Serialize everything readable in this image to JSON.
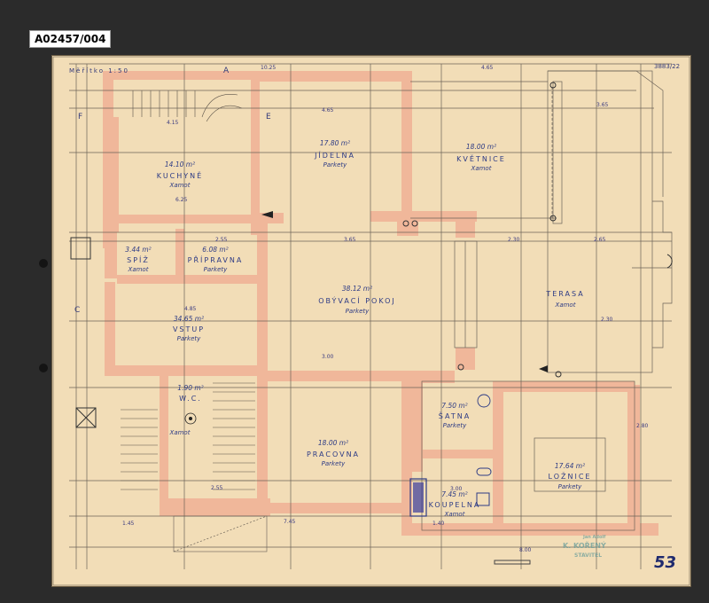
{
  "archive_code": "A02457/004",
  "page_number": "53",
  "scale": "Měřítko 1:50",
  "drawing_number": "3883/22",
  "stamp": {
    "line1": "Jan Adolf",
    "line2": "K. KOŘENÝ",
    "line3": "STAVITEL"
  },
  "section_marks": {
    "a": "A",
    "e": "E",
    "f": "F",
    "c": "C"
  },
  "rooms": [
    {
      "name": "KUCHYNĚ",
      "area": "14.10 m²",
      "floor": "Xamot"
    },
    {
      "name": "JÍDELNA",
      "area": "17.80 m²",
      "floor": "Parkety"
    },
    {
      "name": "KVĚTNICE",
      "area": "18.00 m²",
      "floor": "Xamot"
    },
    {
      "name": "SPÍŽ",
      "area": "3.44 m²",
      "floor": "Xamot"
    },
    {
      "name": "PŘÍPRAVNA",
      "area": "6.08 m²",
      "floor": "Parkety"
    },
    {
      "name": "OBÝVACÍ POKOJ",
      "area": "38.12 m²",
      "floor": "Parkety"
    },
    {
      "name": "TERASA",
      "area": "",
      "floor": "Xamot"
    },
    {
      "name": "VSTUP",
      "area": "34.65 m²",
      "floor": "Parkety"
    },
    {
      "name": "W.C.",
      "area": "1.90 m²",
      "floor": "Xamot"
    },
    {
      "name": "PRACOVNA",
      "area": "18.00 m²",
      "floor": "Parkety"
    },
    {
      "name": "ŠATNA",
      "area": "7.50 m²",
      "floor": "Parkety"
    },
    {
      "name": "LOŽNICE",
      "area": "17.64 m²",
      "floor": "Parkety"
    },
    {
      "name": "KOUPELNA",
      "area": "7.45 m²",
      "floor": "Xamot"
    }
  ],
  "dimensions": {
    "top_overall": "10.25",
    "top_right": "4.65",
    "d1": "4.15",
    "d2": "4.65",
    "d3": "3.65",
    "d4": "2.55",
    "d5": "6.25",
    "d6": "2.30",
    "d7": "2.65",
    "d8": "4.85",
    "d9": "3.00",
    "d10": "3.65",
    "d11": "2.55",
    "d12": "1.45",
    "d13": "7.45",
    "d14": "3.00",
    "d15": "8.00",
    "d16": "2.30",
    "d17": "2.80",
    "d18": "1.40"
  },
  "colors": {
    "paper": "#f2ddb7",
    "walls": "#f0b79a",
    "ink": "#2d3b85",
    "pencil": "#6b6257",
    "background": "#2b2b2b"
  }
}
